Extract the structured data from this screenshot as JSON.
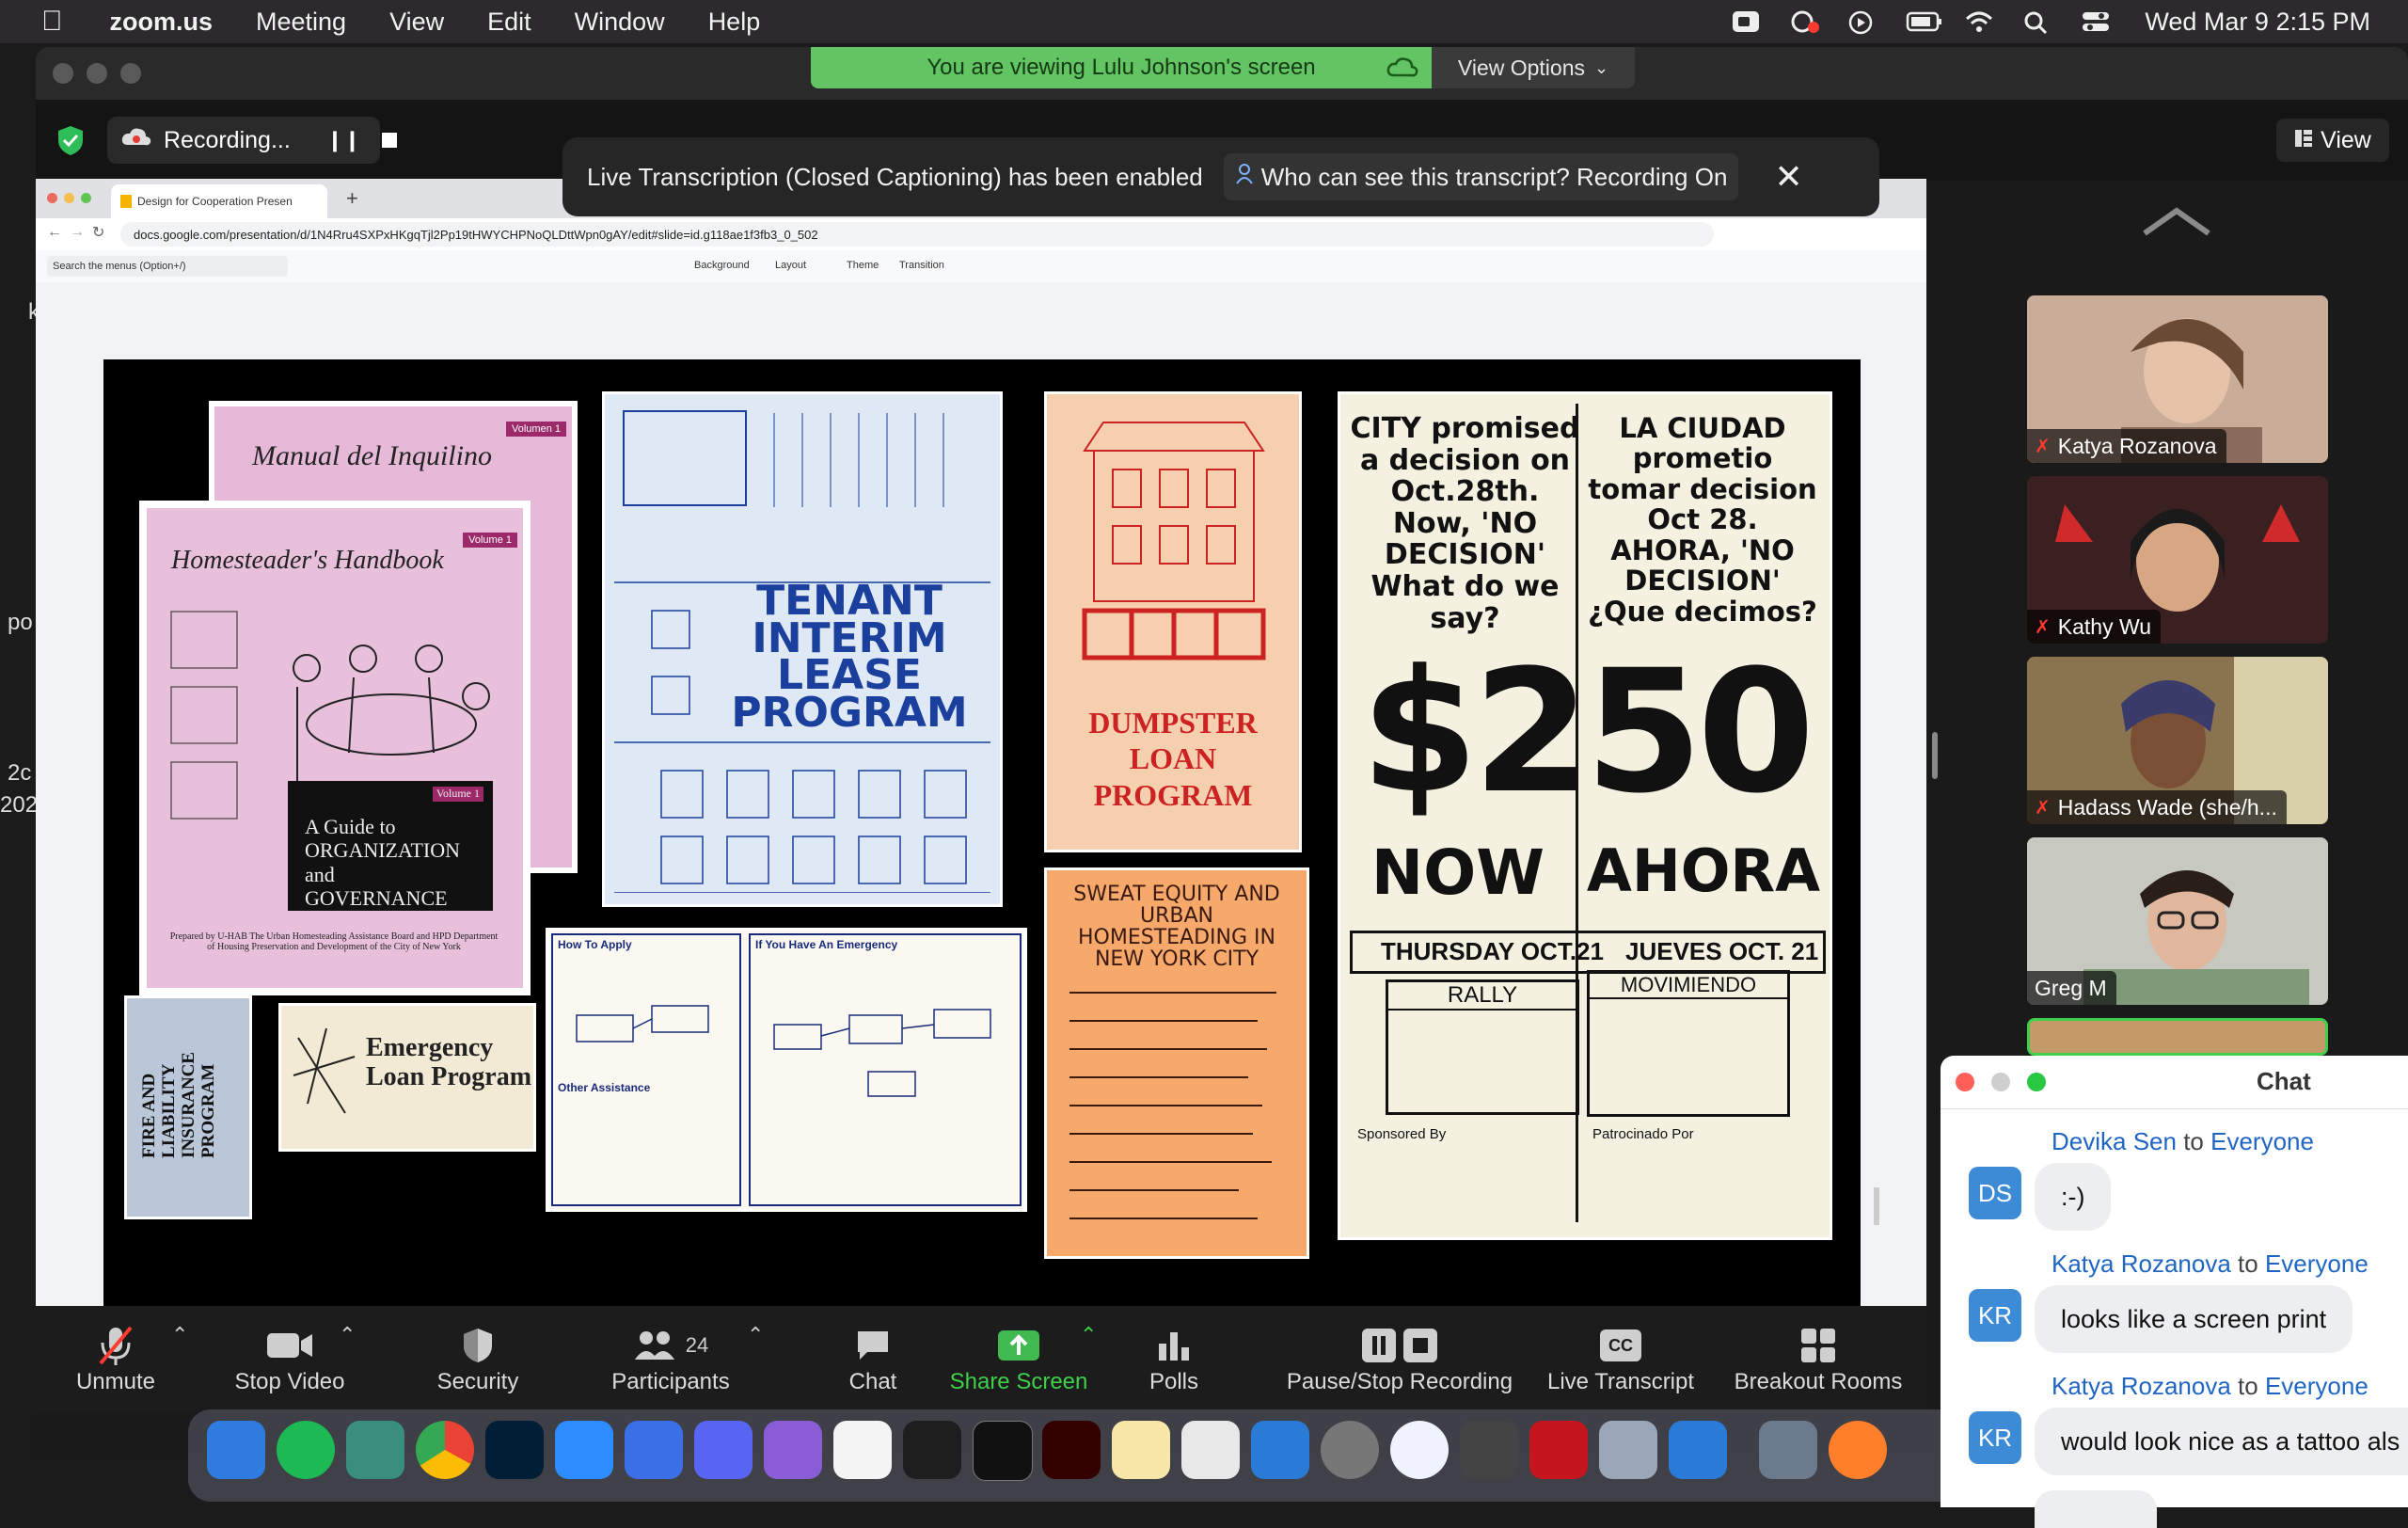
{
  "menubar": {
    "app": "zoom.us",
    "items": [
      "Meeting",
      "View",
      "Edit",
      "Window",
      "Help"
    ],
    "datetime": "Wed Mar 9  2:15 PM"
  },
  "window": {
    "viewing_banner": "You are viewing Lulu Johnson's screen",
    "view_options": "View Options",
    "recording_label": "Recording...",
    "view_button": "View",
    "caption_text": "Live Transcription (Closed Captioning) has been enabled",
    "caption_link": "Who can see this transcript? Recording On"
  },
  "browser": {
    "tab_title": "Design for Cooperation Presen",
    "url": "docs.google.com/presentation/d/1N4Rru4SXPxHKgqTjl2Pp19tHWYCHPNoQLDttWpn0gAY/edit#slide=id.g118ae1f3fb3_0_502",
    "search_menus": "Search the menus (Option+/)",
    "toolbar": [
      "Background",
      "Layout",
      "Theme",
      "Transition"
    ]
  },
  "slide": {
    "manual": "Manual del Inquilino",
    "volumen": "Volumen 1",
    "homesteader": "Homesteader's Handbook",
    "volume": "Volume 1",
    "guide_vol": "Volume 1",
    "guide": "A Guide to ORGANIZATION and GOVERNANCE",
    "prepared": "Prepared by U-HAB The Urban Homesteading Assistance Board and HPD Department of Housing Preservation and Development of the City of New York",
    "tenant": "TENANT INTERIM LEASE PROGRAM",
    "dumpster": "DUMPSTER LOAN PROGRAM",
    "fire": "FIRE AND LIABILITY INSURANCE PROGRAM",
    "emergency": "Emergency Loan Program",
    "how_apply": "How To Apply",
    "if_emergency": "If You Have An Emergency",
    "other_assist": "Other Assistance",
    "sweat": "SWEAT EQUITY AND URBAN HOMESTEADING IN NEW YORK CITY",
    "city_en": "CITY promised a decision on Oct.28th. Now, 'NO DECISION' What do we say?",
    "city_es": "LA CIUDAD prometio tomar decision Oct 28. AHORA, 'NO DECISION' ¿Que decimos?",
    "amount": "$250",
    "now": "NOW",
    "ahora": "AHORA",
    "thursday": "THURSDAY OCT.21",
    "jueves": "JUEVES OCT. 21",
    "rally": "RALLY",
    "movimiento": "MOVIMIENDO",
    "sponsored": "Sponsored By",
    "patrocinado": "Patrocinado Por"
  },
  "participants": [
    {
      "name": "Katya Rozanova",
      "muted": true
    },
    {
      "name": "Kathy Wu",
      "muted": true
    },
    {
      "name": "Hadass Wade (she/h...",
      "muted": true
    },
    {
      "name": "Greg M",
      "muted": false
    }
  ],
  "toolbar": {
    "unmute": "Unmute",
    "stop_video": "Stop Video",
    "security": "Security",
    "participants": "Participants",
    "participants_count": "24",
    "chat": "Chat",
    "share_screen": "Share Screen",
    "polls": "Polls",
    "pause_stop": "Pause/Stop Recording",
    "live_transcript": "Live Transcript",
    "cc": "CC",
    "breakout": "Breakout Rooms"
  },
  "chat": {
    "title": "Chat",
    "messages": [
      {
        "from": "Devika Sen",
        "to": "Everyone",
        "initials": "DS",
        "text": ":-)"
      },
      {
        "from": "Katya Rozanova",
        "to": "Everyone",
        "initials": "KR",
        "text": "looks like a screen print"
      },
      {
        "from": "Katya Rozanova",
        "to": "Everyone",
        "initials": "KR",
        "text": "would look nice as a tattoo als"
      }
    ],
    "to_word": "to"
  },
  "side_text": [
    "k",
    "po",
    "2c",
    "202"
  ],
  "colors": {
    "banner_green": "#62c462",
    "share_green": "#3fb950",
    "chat_blue": "#1f66c4",
    "mute_red": "#ff3b30"
  }
}
